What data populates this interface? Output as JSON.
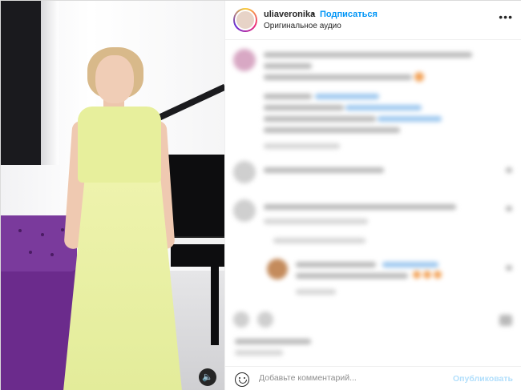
{
  "post": {
    "username": "uliaveronika",
    "separator": "•",
    "follow_label": "Подписаться",
    "audio_label": "Оригинальное аудио",
    "more_icon": "more-horizontal-icon"
  },
  "video": {
    "sound_icon": "speaker-icon",
    "sound_glyph": "🔈"
  },
  "comment_box": {
    "placeholder": "Добавьте комментарий...",
    "publish_label": "Опубликовать",
    "emoji_icon": "emoji-icon"
  },
  "colors": {
    "accent": "#0095f6",
    "publish_disabled": "#b2dffc",
    "text": "#262626",
    "muted": "#8e8e8e"
  }
}
